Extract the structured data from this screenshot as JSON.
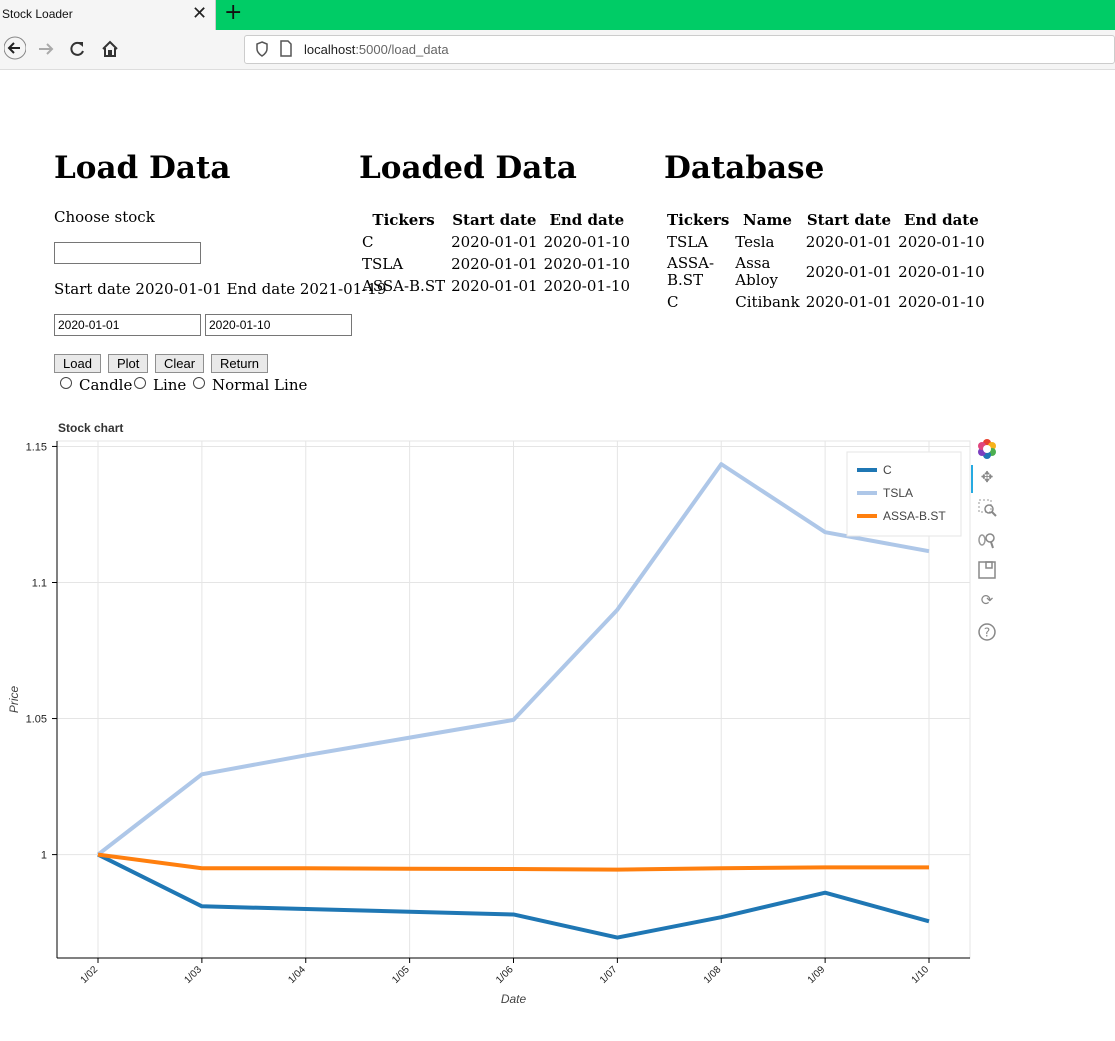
{
  "browser": {
    "tab_title": "Stock Loader",
    "tab_close": "✕",
    "new_tab": "+",
    "url_host": "localhost",
    "url_rest": ":5000/load_data"
  },
  "load": {
    "heading": "Load Data",
    "choose_label": "Choose stock",
    "stock_value": "",
    "dates_text": "Start date 2020-01-01 End date 2021-01-19",
    "start_value": "2020-01-01",
    "end_value": "2020-01-10",
    "buttons": [
      "Load",
      "Plot",
      "Clear",
      "Return"
    ],
    "radios": [
      "Candle",
      "Line",
      "Normal Line"
    ]
  },
  "loaded": {
    "heading": "Loaded Data",
    "columns": [
      "Tickers",
      "Start date",
      "End date"
    ],
    "rows": [
      [
        "C",
        "2020-01-01",
        "2020-01-10"
      ],
      [
        "TSLA",
        "2020-01-01",
        "2020-01-10"
      ],
      [
        "ASSA-B.ST",
        "2020-01-01",
        "2020-01-10"
      ]
    ]
  },
  "database": {
    "heading": "Database",
    "columns": [
      "Tickers",
      "Name",
      "Start date",
      "End date"
    ],
    "rows": [
      [
        "TSLA",
        "Tesla",
        "2020-01-01",
        "2020-01-10"
      ],
      [
        "ASSA-\nB.ST",
        "Assa\nAbloy",
        "2020-01-01",
        "2020-01-10"
      ],
      [
        "C",
        "Citibank",
        "2020-01-01",
        "2020-01-10"
      ]
    ]
  },
  "chart_data": {
    "type": "line",
    "title": "Stock chart",
    "xlabel": "Date",
    "ylabel": "Price",
    "x": [
      "1/02",
      "1/03",
      "1/04",
      "1/05",
      "1/06",
      "1/07",
      "1/08",
      "1/09",
      "1/10"
    ],
    "ylim": [
      0.962,
      1.152
    ],
    "yticks": [
      1,
      1.05,
      1.1,
      1.15
    ],
    "ytick_labels": [
      "1",
      "1.05",
      "1.1",
      "1.15"
    ],
    "grid": true,
    "legend_position": "top-right",
    "series": [
      {
        "name": "C",
        "color": "#1f77b4",
        "values": [
          1.0,
          0.981,
          0.98,
          0.979,
          0.978,
          0.9695,
          0.977,
          0.986,
          0.9755
        ]
      },
      {
        "name": "TSLA",
        "color": "#aec7e8",
        "values": [
          1.0,
          1.0295,
          1.0365,
          1.043,
          1.0495,
          1.09,
          1.1435,
          1.1185,
          1.1115
        ]
      },
      {
        "name": "ASSA-B.ST",
        "color": "#ff7f0e",
        "values": [
          1.0,
          0.995,
          0.995,
          0.9948,
          0.9947,
          0.9945,
          0.995,
          0.9953,
          0.9953
        ]
      }
    ]
  },
  "toolbar": {
    "icons": [
      "bokeh-logo-icon",
      "pan-icon",
      "box-zoom-icon",
      "wheel-zoom-icon",
      "save-icon",
      "reset-icon",
      "help-icon"
    ]
  }
}
